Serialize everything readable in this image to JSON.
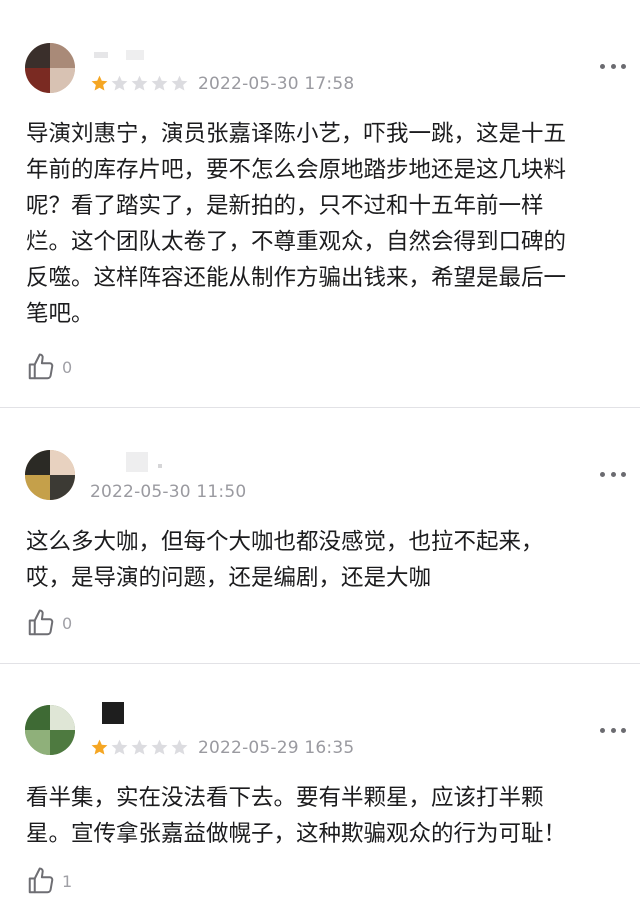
{
  "comments": [
    {
      "rating": 1,
      "date": "2022-05-30 17:58",
      "text": "导演刘惠宁，演员张嘉译陈小艺，吓我一跳，这是十五\n年前的库存片吧，要不怎么会原地踏步地还是这几块料\n呢？看了踏实了，是新拍的，只不过和十五年前一样\n烂。这个团队太卷了，不尊重观众，自然会得到口碑的\n反噬。这样阵容还能从制作方骗出钱来，希望是最后一\n笔吧。",
      "likes": "0"
    },
    {
      "date": "2022-05-30 11:50",
      "text": "这么多大咖，但每个大咖也都没感觉，也拉不起来，\n哎，是导演的问题，还是编剧，还是大咖",
      "likes": "0"
    },
    {
      "rating": 1,
      "date": "2022-05-29 16:35",
      "text": "看半集，实在没法看下去。要有半颗星，应该打半颗\n星。宣传拿张嘉益做幌子，这种欺骗观众的行为可耻！",
      "likes": "1"
    }
  ],
  "icons": {
    "star": "star-icon",
    "like": "thumbs-up-icon",
    "more": "more-icon"
  },
  "colors": {
    "star_filled": "#f5a623",
    "star_empty": "#dcdce0",
    "text": "#1c1c1e",
    "meta": "#9a9aa0"
  }
}
